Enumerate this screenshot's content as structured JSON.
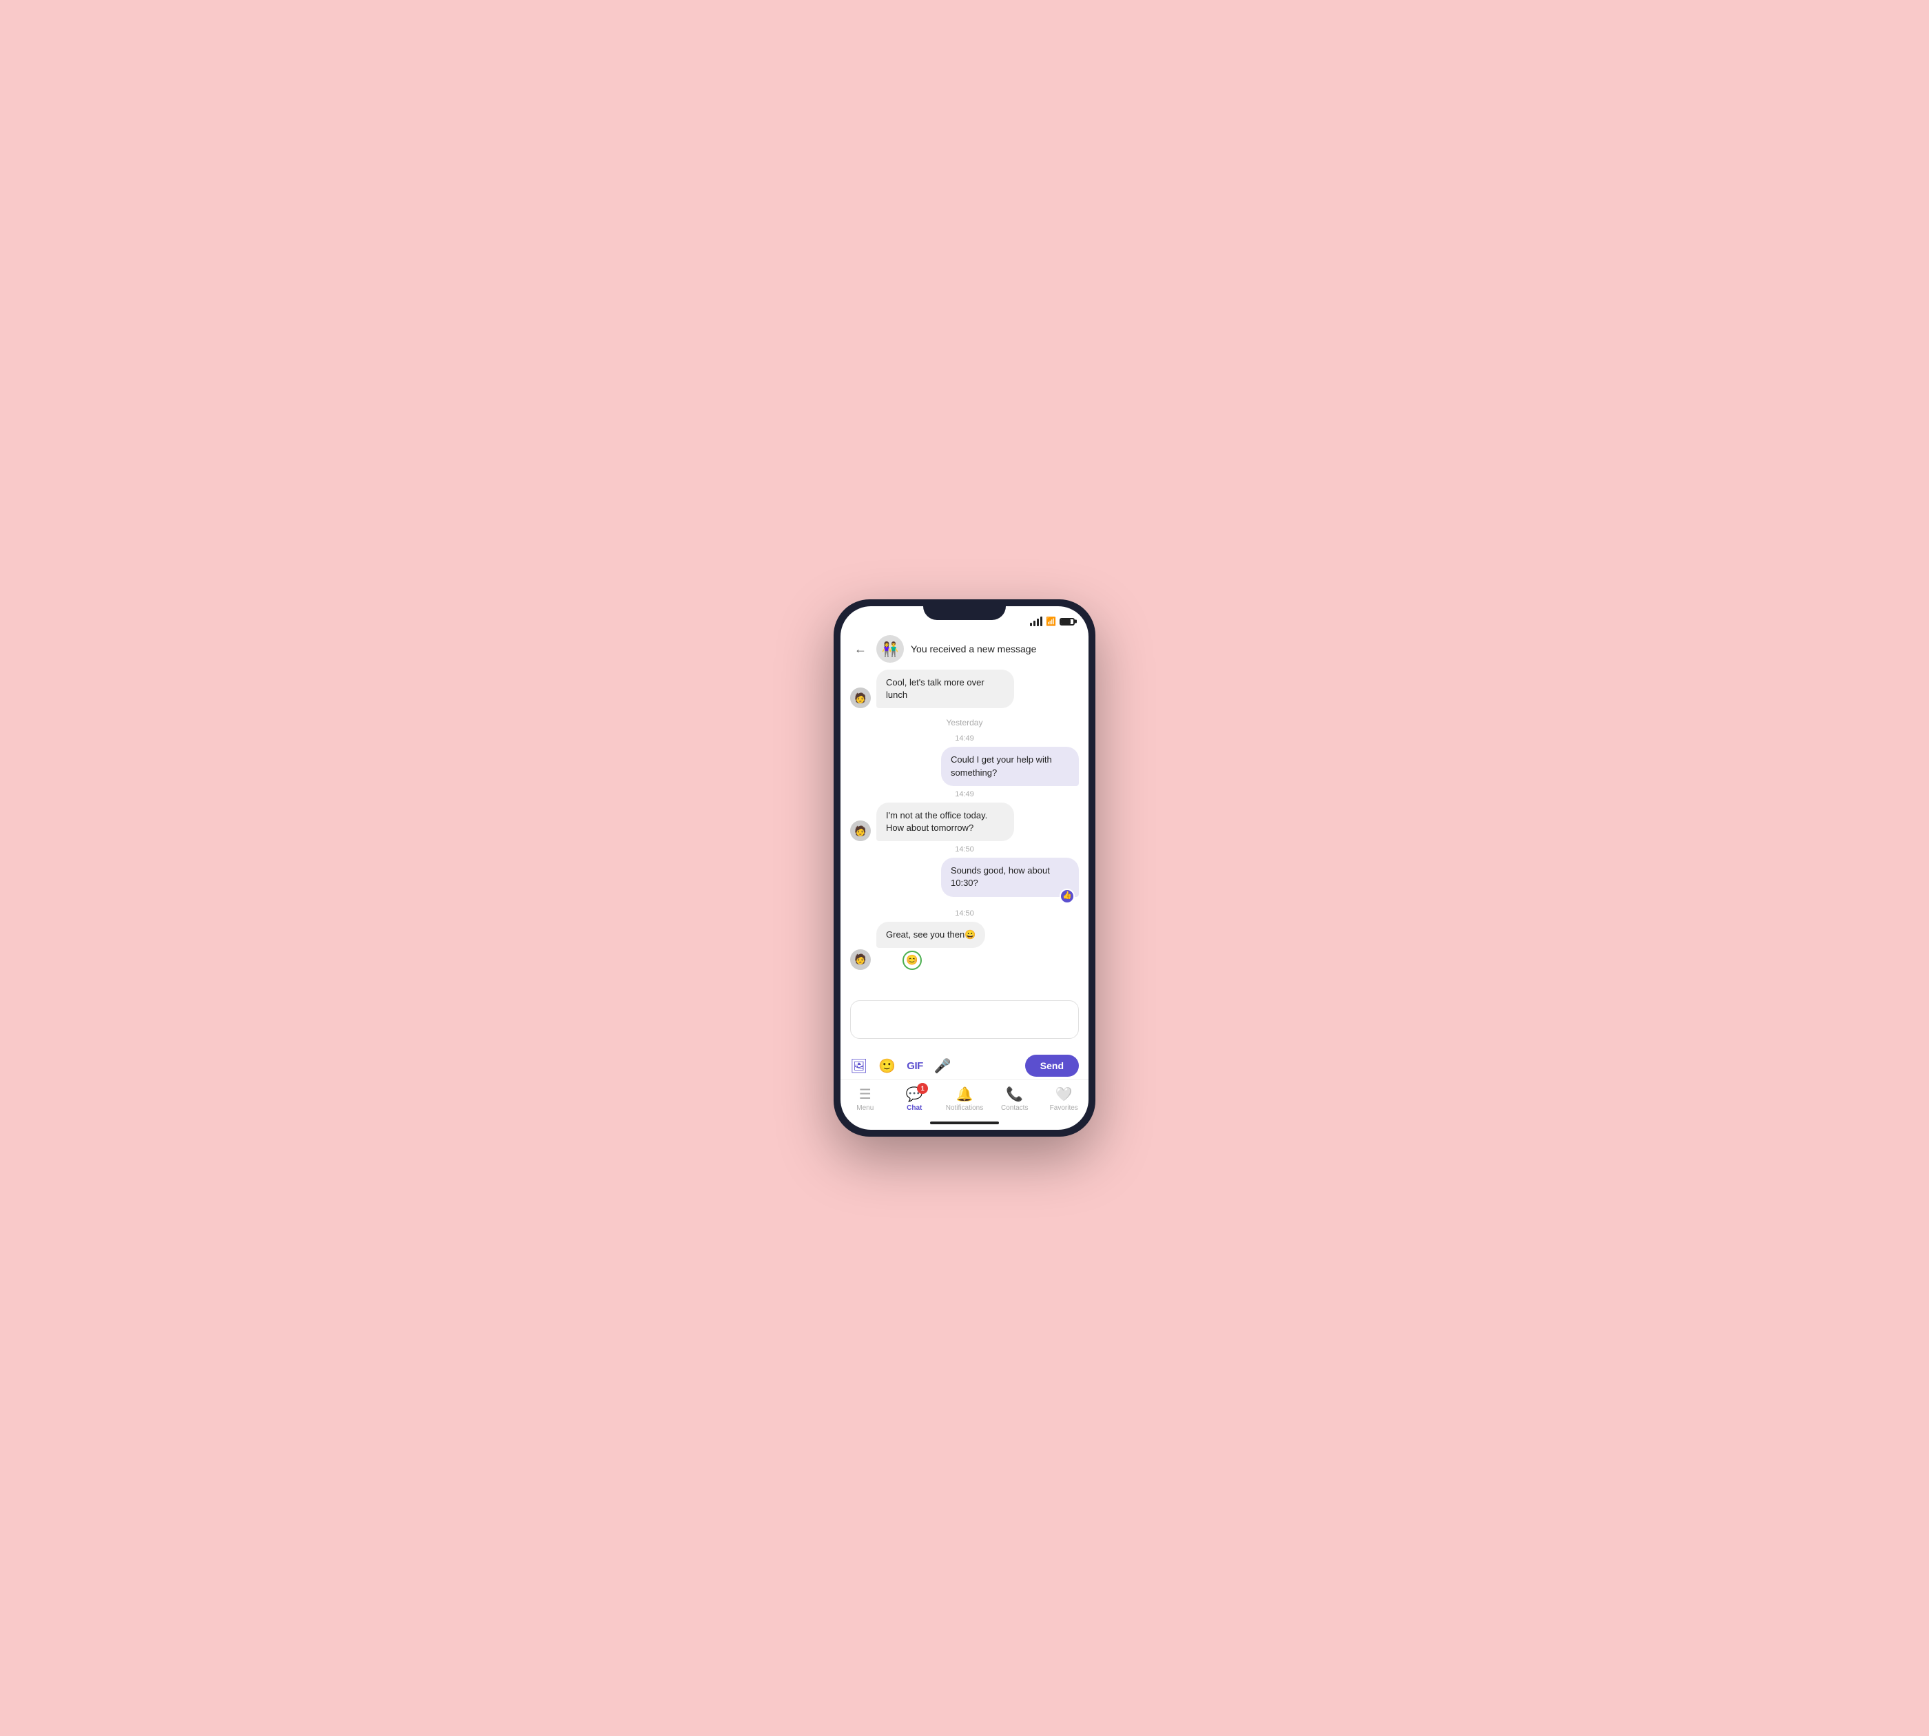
{
  "phone": {
    "status_bar": {
      "signal": "signal",
      "wifi": "wifi",
      "battery": "battery"
    },
    "header": {
      "back_label": "←",
      "title": "You received a new message"
    },
    "chat": {
      "clipped_message": "Cool, let's talk more over lunch",
      "date_divider": "Yesterday",
      "messages": [
        {
          "id": 1,
          "type": "outgoing",
          "time": "14:49",
          "text": "Could I get your help with something?",
          "reaction": null
        },
        {
          "id": 2,
          "type": "incoming",
          "time": "14:49",
          "text": "I'm not at the office today. How about tomorrow?",
          "reaction": null
        },
        {
          "id": 3,
          "type": "outgoing",
          "time": "14:50",
          "text": "Sounds good, how about 10:30?",
          "reaction": "👍"
        },
        {
          "id": 4,
          "type": "incoming",
          "time": "14:50",
          "text": "Great, see you then😀",
          "reaction": "😊"
        }
      ]
    },
    "toolbar": {
      "send_label": "Send"
    },
    "bottom_nav": {
      "items": [
        {
          "id": "menu",
          "label": "Menu",
          "icon": "menu",
          "active": false,
          "badge": null
        },
        {
          "id": "chat",
          "label": "Chat",
          "icon": "chat",
          "active": true,
          "badge": "1"
        },
        {
          "id": "notifications",
          "label": "Notifications",
          "icon": "bell",
          "active": false,
          "badge": null
        },
        {
          "id": "contacts",
          "label": "Contacts",
          "icon": "phone",
          "active": false,
          "badge": null
        },
        {
          "id": "favorites",
          "label": "Favorites",
          "icon": "heart",
          "active": false,
          "badge": null
        }
      ]
    }
  }
}
